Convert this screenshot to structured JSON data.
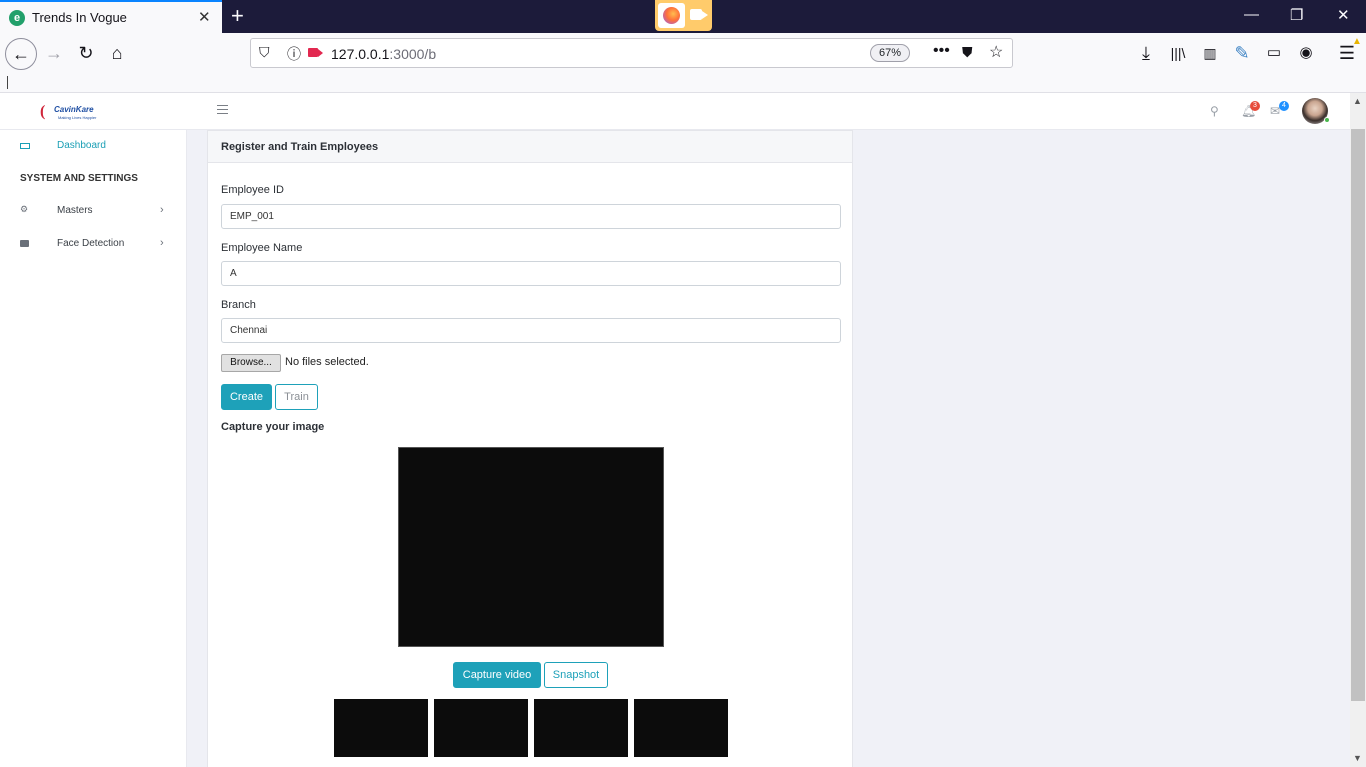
{
  "browser": {
    "tab_title": "Trends In Vogue",
    "tab_favicon_letter": "e",
    "url_host": "127.0.0.1",
    "url_path": ":3000/b",
    "zoom": "67%",
    "new_tab_glyph": "+",
    "icons": [
      "back-icon",
      "forward-icon",
      "reload-icon",
      "home-icon",
      "shield-icon",
      "info-icon",
      "camera-sharing-icon",
      "more-icon",
      "pocket-icon",
      "bookmark-star-icon",
      "download-icon",
      "library-icon",
      "sidebar-icon",
      "extension-icon",
      "container-icon",
      "account-icon",
      "menu-icon"
    ]
  },
  "header": {
    "logo_word": "CavinKare",
    "logo_tagline": "Making Lives Happier",
    "notifications_count": "3",
    "messages_count": "4",
    "colors": {
      "notification_badge": "#e74c3c",
      "message_badge": "#1e90ff",
      "accent": "#1ea1b9"
    }
  },
  "sidebar": {
    "items": [
      {
        "label": "Dashboard",
        "icon": "laptop-icon"
      },
      {
        "label": "Masters",
        "icon": "gears-icon"
      },
      {
        "label": "Face Detection",
        "icon": "camera-icon"
      }
    ],
    "section_heading": "SYSTEM AND SETTINGS"
  },
  "form": {
    "title": "Register and Train Employees",
    "employee_id_label": "Employee ID",
    "employee_id_value": "EMP_001",
    "employee_name_label": "Employee Name",
    "employee_name_value": "A",
    "branch_label": "Branch",
    "branch_value": "Chennai",
    "browse_label": "Browse...",
    "file_status": "No files selected.",
    "create_label": "Create",
    "train_label": "Train",
    "capture_heading": "Capture your image",
    "capture_video_label": "Capture video",
    "snapshot_label": "Snapshot"
  }
}
